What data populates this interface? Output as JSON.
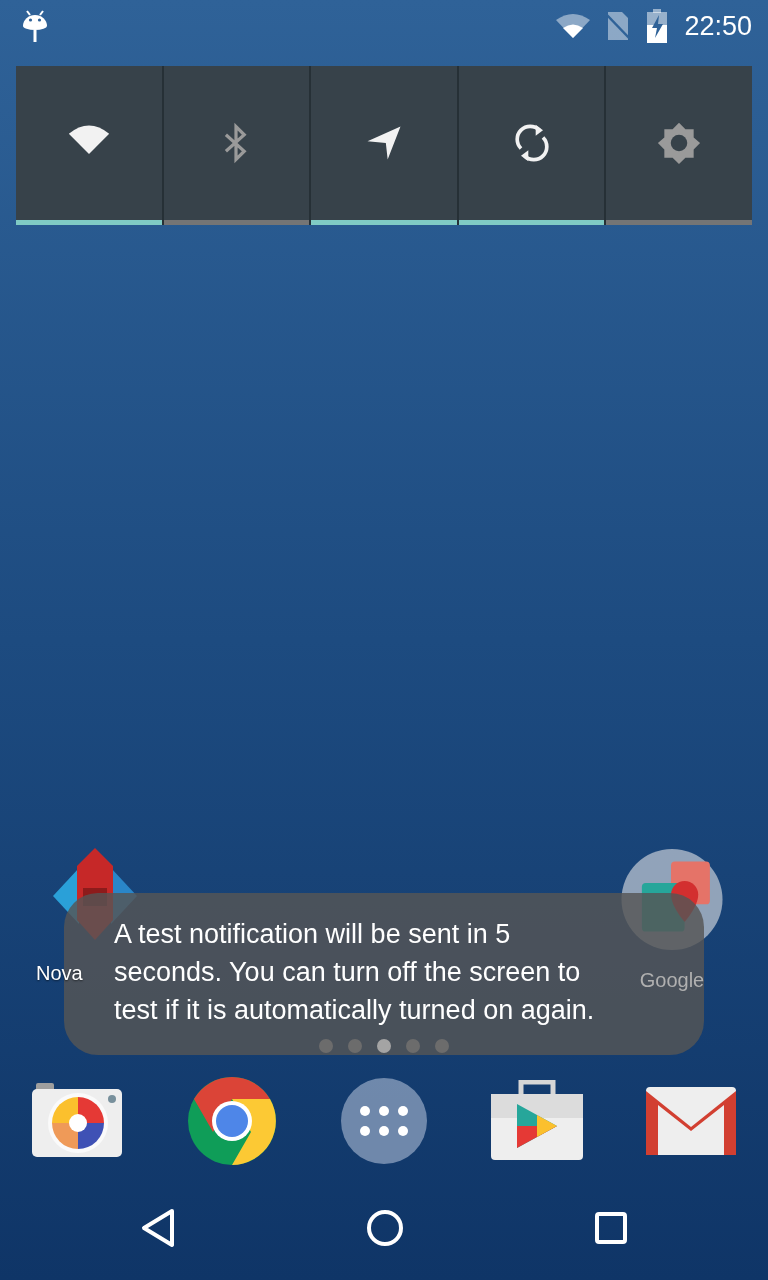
{
  "status_bar": {
    "time": "22:50"
  },
  "quick_settings": [
    {
      "kind": "wifi",
      "on": true
    },
    {
      "kind": "bluetooth",
      "on": false
    },
    {
      "kind": "location",
      "on": true
    },
    {
      "kind": "sync",
      "on": true
    },
    {
      "kind": "brightness",
      "on": false
    }
  ],
  "home_apps": [
    {
      "kind": "nova",
      "label": "Nova"
    },
    {
      "kind": "folder",
      "label": "Google"
    }
  ],
  "toast": {
    "message": "A test notification will be sent in 5 seconds. You can turn off the screen to test if it is automatically turned on again."
  },
  "pages": [
    {
      "selected": false
    },
    {
      "selected": false
    },
    {
      "selected": true
    },
    {
      "selected": false
    },
    {
      "selected": false
    }
  ],
  "dock": [
    {
      "kind": "camera"
    },
    {
      "kind": "browser"
    },
    {
      "kind": "drawer"
    },
    {
      "kind": "store"
    },
    {
      "kind": "mail"
    }
  ],
  "nav": [
    {
      "kind": "back"
    },
    {
      "kind": "home"
    },
    {
      "kind": "recents"
    }
  ]
}
